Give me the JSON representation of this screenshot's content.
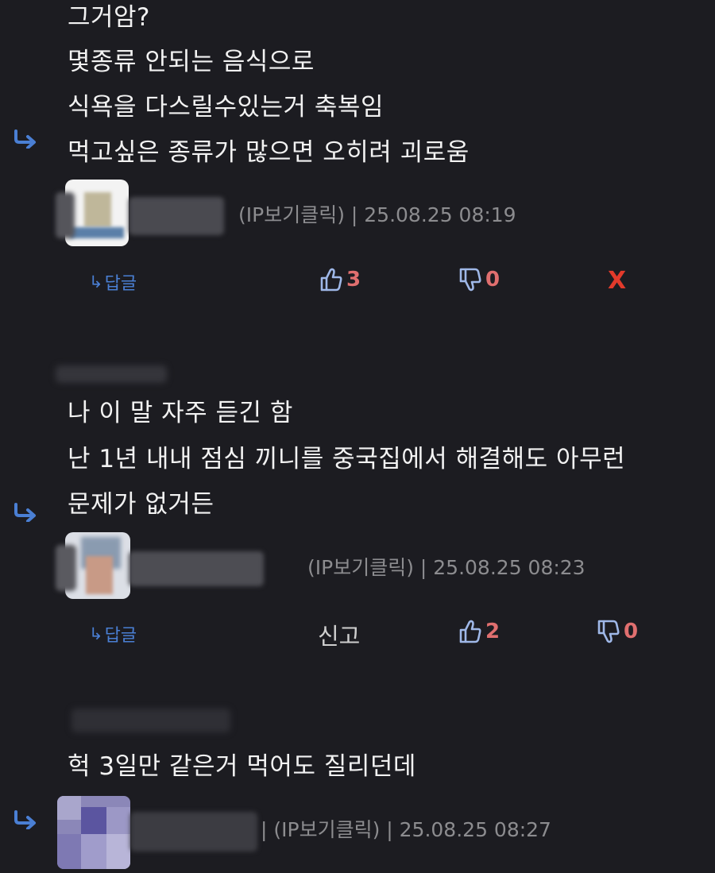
{
  "comments": [
    {
      "lines": [
        "그거암?",
        "몇종류 안되는 음식으로",
        "식욕을 다스릴수있는거 축복임",
        "먹고싶은 종류가 많으면 오히려 괴로움"
      ],
      "meta": "(IP보기클릭) | 25.08.25 08:19",
      "reply_label": "답글",
      "likes": "3",
      "dislikes": "0",
      "delete_label": "X"
    },
    {
      "lines": [
        "나 이 말 자주 듣긴 함",
        "난 1년 내내 점심 끼니를 중국집에서 해결해도 아무런",
        "문제가 없거든"
      ],
      "meta": "(IP보기클릭) | 25.08.25 08:23",
      "reply_label": "답글",
      "report_label": "신고",
      "likes": "2",
      "dislikes": "0"
    },
    {
      "lines": [
        "헉 3일만 같은거 먹어도 질리던데"
      ],
      "meta": "| (IP보기클릭) | 25.08.25 08:27"
    }
  ],
  "icons": {
    "reply_arrow": "reply-arrow-icon",
    "thumb_up": "thumbs-up-icon",
    "thumb_down": "thumbs-down-icon"
  },
  "colors": {
    "background": "#1c1c21",
    "accent_blue": "#4a7fd4",
    "count_red": "#e06f6f",
    "delete_red": "#e23a2b",
    "meta_gray": "#8c8c8f"
  }
}
